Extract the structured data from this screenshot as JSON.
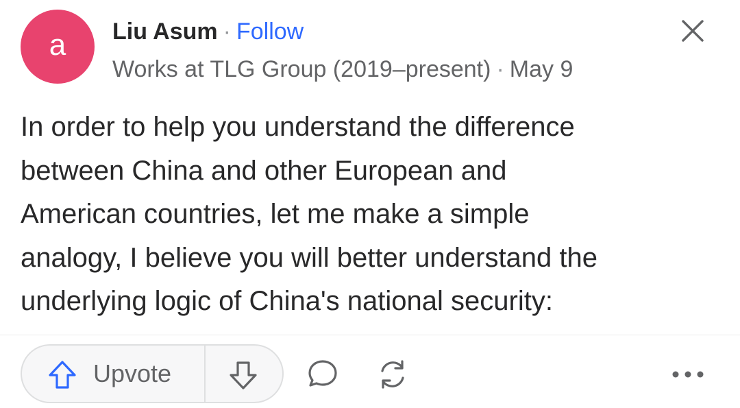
{
  "post": {
    "author": {
      "avatar_letter": "a",
      "avatar_color": "#e8436e",
      "name": "Liu Asum",
      "follow_label": "Follow",
      "credential": "Works at TLG Group (2019–present)",
      "date": "May 9",
      "separator": "·"
    },
    "close_icon": "close-icon",
    "body_lines": [
      "In order to help you understand the difference",
      "between China and other European and",
      "American countries, let me make a simple",
      "analogy, I believe you will better understand the",
      "underlying logic of China's national security:"
    ]
  },
  "actions": {
    "upvote_label": "Upvote",
    "upvote_icon": "arrow-up-icon",
    "downvote_icon": "arrow-down-icon",
    "comment_icon": "comment-bubble-icon",
    "share_icon": "share-rotate-icon",
    "more_icon": "more-dots-icon",
    "accent_color": "#2e69ff"
  }
}
